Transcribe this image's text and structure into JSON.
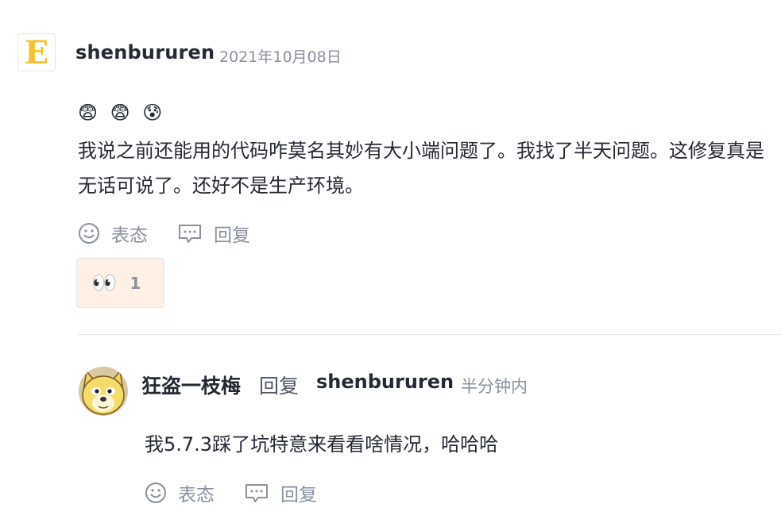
{
  "comment": {
    "avatar_letter": "E",
    "username": "shenbururen",
    "date": "2021年10月08日",
    "emojis": "😨 😨 😰",
    "text": "我说之前还能用的代码咋莫名其妙有大小端问题了。我找了半天问题。这修复真是无话可说了。还好不是生产环境。",
    "like_label": "表态",
    "reply_label": "回复",
    "reaction": {
      "emoji": "👀",
      "count": "1"
    }
  },
  "reply": {
    "username": "狂盗一枝梅",
    "verb": "回复",
    "target": "shenbururen",
    "time": "半分钟内",
    "text": "我5.7.3踩了坑特意来看看啥情况，哈哈哈",
    "like_label": "表态",
    "reply_label": "回复"
  }
}
